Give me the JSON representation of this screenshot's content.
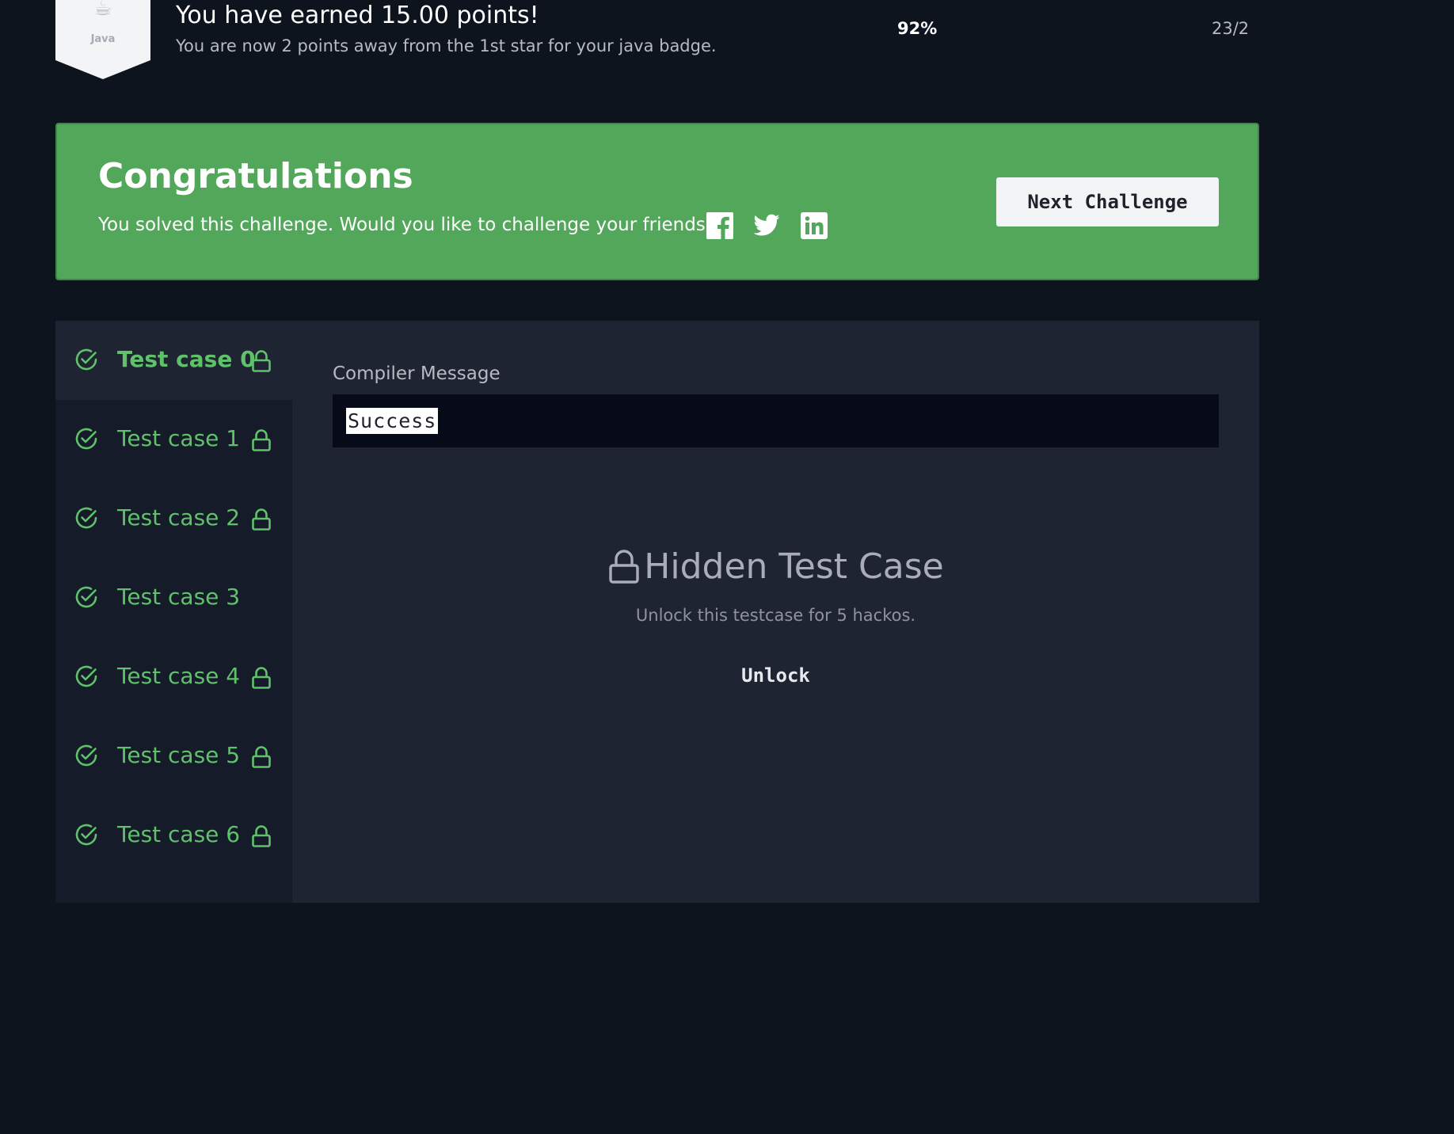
{
  "header": {
    "badge_label": "Java",
    "earned_title": "You have earned 15.00 points!",
    "earned_subtitle": "You are now 2 points away from the 1st star for your java badge.",
    "percent": "92%",
    "rank": "23/2"
  },
  "congrats": {
    "title": "Congratulations",
    "message": "You solved this challenge. Would you like to challenge your friends?",
    "social_icons": [
      "facebook-icon",
      "twitter-icon",
      "linkedin-icon"
    ],
    "next_button_label": "Next Challenge",
    "background_color": "#52a75a"
  },
  "test_cases": [
    {
      "label": "Test case 0",
      "passed": true,
      "locked": true,
      "active": true
    },
    {
      "label": "Test case 1",
      "passed": true,
      "locked": true,
      "active": false
    },
    {
      "label": "Test case 2",
      "passed": true,
      "locked": true,
      "active": false
    },
    {
      "label": "Test case 3",
      "passed": true,
      "locked": false,
      "active": false
    },
    {
      "label": "Test case 4",
      "passed": true,
      "locked": true,
      "active": false
    },
    {
      "label": "Test case 5",
      "passed": true,
      "locked": true,
      "active": false
    },
    {
      "label": "Test case 6",
      "passed": true,
      "locked": true,
      "active": false
    }
  ],
  "compiler": {
    "label": "Compiler Message",
    "message": "Success"
  },
  "hidden": {
    "title": "Hidden Test Case",
    "message": "Unlock this testcase for 5 hackos.",
    "unlock_label": "Unlock"
  },
  "colors": {
    "accent_green": "#5fc26b",
    "page_bg": "#0e141e",
    "panel_bg": "#1f2433"
  }
}
